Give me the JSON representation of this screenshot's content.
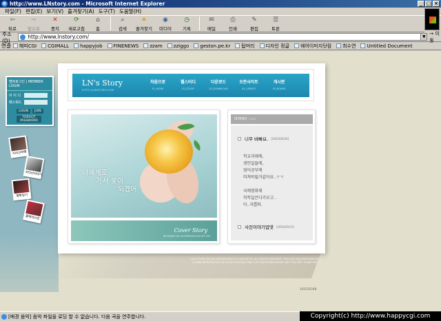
{
  "window": {
    "title": "http://www.LNstory.com - Microsoft Internet Explorer",
    "min": "_",
    "max": "□",
    "close": "×"
  },
  "menu": [
    "파일(F)",
    "편집(E)",
    "보기(V)",
    "즐겨찾기(A)",
    "도구(T)",
    "도움말(H)"
  ],
  "toolbar": [
    {
      "label": "뒤로",
      "icon": "back-arrow-icon",
      "glyph": "⇦"
    },
    {
      "label": "앞으로",
      "icon": "forward-arrow-icon",
      "glyph": "⇨"
    },
    {
      "label": "중지",
      "icon": "stop-icon",
      "glyph": "✕"
    },
    {
      "label": "새로고침",
      "icon": "refresh-icon",
      "glyph": "⟳"
    },
    {
      "label": "홈",
      "icon": "home-icon",
      "glyph": "⌂"
    },
    {
      "label": "검색",
      "icon": "search-icon",
      "glyph": "⌕"
    },
    {
      "label": "즐겨찾기",
      "icon": "favorites-icon",
      "glyph": "★"
    },
    {
      "label": "미디어",
      "icon": "media-icon",
      "glyph": "◉"
    },
    {
      "label": "기록",
      "icon": "history-icon",
      "glyph": "◷"
    },
    {
      "label": "메일",
      "icon": "mail-icon",
      "glyph": "✉"
    },
    {
      "label": "인쇄",
      "icon": "print-icon",
      "glyph": "⎙"
    },
    {
      "label": "편집",
      "icon": "edit-icon",
      "glyph": "✎"
    },
    {
      "label": "토론",
      "icon": "discuss-icon",
      "glyph": "☰"
    }
  ],
  "address": {
    "label": "주소(D)",
    "url": "http://www.lnstory.com/",
    "go": "→ 이동"
  },
  "links": {
    "label": "연결",
    "items": [
      "해피CGI",
      "CGIMALL",
      "happyjob",
      "FINENEWS",
      "zzam",
      "zziggo",
      "geston.pe.kr",
      "탑머리",
      "디자인 정글",
      "웨어이미지닷컴",
      "최수연",
      "Untitled Document"
    ]
  },
  "site": {
    "login": {
      "title": "멤버로그인 | MEMBER LOGIN",
      "id_label": "아 이 디",
      "pw_label": "패스워드",
      "login_btn": "LOGIN",
      "join_btn": "JOIN",
      "forgot_btn": "FORGOT PASSWORD"
    },
    "photos": [
      "지리산여행",
      "지리산이야기",
      "영화일기",
      "올해의사진"
    ],
    "logo": "LN's Story",
    "logo_sub": "HTTP://LNSTORY.COM",
    "nav": [
      {
        "label": "처음으로",
        "sub": "01_HOME"
      },
      {
        "label": "웹스터디",
        "sub": "02_STUDY"
      },
      {
        "label": "다운로드",
        "sub": "03_DOWNLOAD"
      },
      {
        "label": "오픈사이트",
        "sub": "04_UPDATE"
      },
      {
        "label": "게시판",
        "sub": "05_BOARD"
      }
    ],
    "hero_text": [
      "너에게로",
      "가서 꽃이",
      "되겠어"
    ],
    "cover_title": "Cover Story",
    "cover_sub": "DESIGNED BY LN REPRODUCED BY SSS",
    "diary": {
      "header": "미미레이",
      "header_sub": "| Line",
      "entry1_title": "너무 바빠요.",
      "entry1_date": "[2003/06/26]",
      "lines": [
        "학교과제에,",
        "생인일들에,",
        "영어공부에",
        "미쳐버릴거같아요..ㅜㅜ",
        "",
        "국제영화제",
        "저작일은다가오고..",
        "아..괴롭따."
      ],
      "entry2_title": "사진이야기업댓",
      "entry2_date": "[2003/05/15]"
    },
    "footer_text": "LN'S STORY ORIGIN: DESIGN RIGHT (C) 2003 BY LN. ALL RIGHTS RESERVED. THIS SITE WAS DESIGNED BY LN AND REPRODUCED FOR STUDY PURPOSE ONLY. FOR QUESTIONS PLEASE VISIT THE SITE. THANK YOU.",
    "counter": "163/26348"
  },
  "status": {
    "text": "[배경 음악] 음악 파일을 로딩 할 수 없습니다. 다음 곡을 연주합니다."
  },
  "copyright": "Copyright(c) http://www.happycgi.com"
}
